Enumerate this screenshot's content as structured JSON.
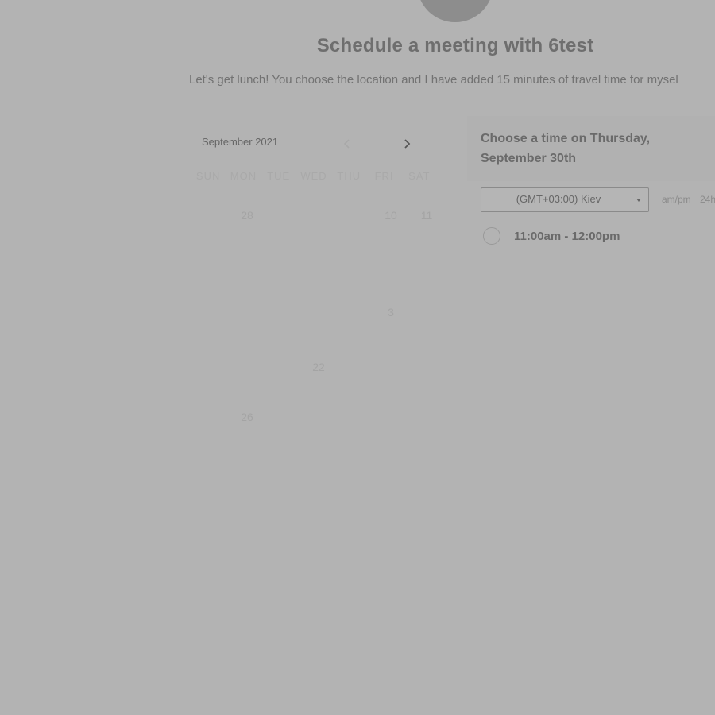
{
  "header": {
    "title": "Schedule a meeting with 6test",
    "description": "Let's get lunch! You choose the location and I have added 15 minutes of travel time for mysel"
  },
  "calendar": {
    "month_label": "September 2021",
    "prev_icon": "chevron-left-icon",
    "next_icon": "chevron-right-icon",
    "weekdays": [
      "SUN",
      "MON",
      "TUE",
      "WED",
      "THU",
      "FRI",
      "SAT"
    ],
    "visible_days": {
      "d28": "28",
      "d10": "10",
      "d11": "11",
      "d3": "3",
      "d22": "22",
      "d26": "26"
    }
  },
  "time_panel": {
    "title": "Choose a time on Thursday, September 30th",
    "timezone": "(GMT+03:00) Kiev",
    "format_ampm": "am/pm",
    "format_24h": "24h",
    "slots": [
      "11:00am - 12:00pm"
    ]
  }
}
